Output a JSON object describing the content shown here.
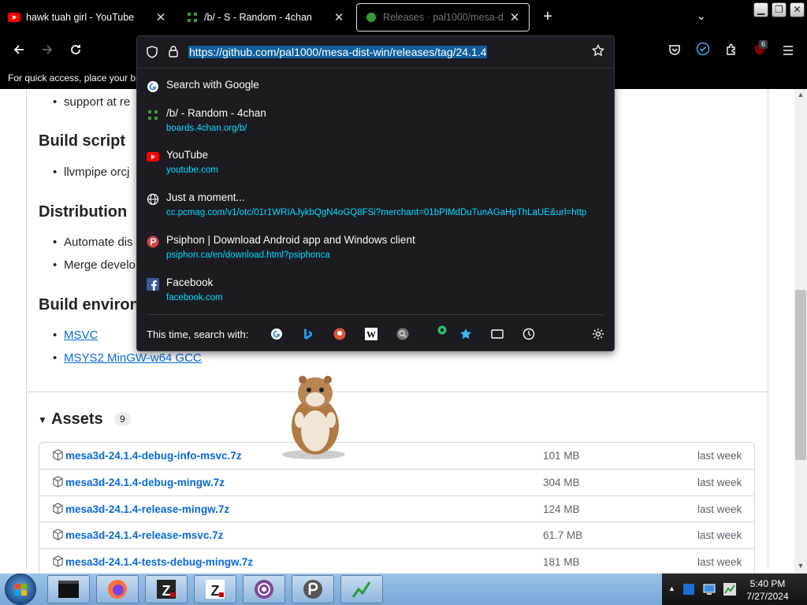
{
  "browser": {
    "tabs": [
      {
        "title": "hawk tuah girl - YouTube",
        "close": "✕"
      },
      {
        "title": "/b/ - S - Random - 4chan",
        "close": "✕"
      },
      {
        "title": "Releases · pal1000/mesa-d",
        "close": "✕"
      }
    ],
    "new_tab": "+",
    "list_tabs": "⌄",
    "window_controls": {
      "minimize": "▁",
      "restore": "❐",
      "close": "✕"
    },
    "extension_badge": "6",
    "bookmarks_text": "For quick access, place your bo"
  },
  "urlbar": {
    "url": "https://github.com/pal1000/mesa-dist-win/releases/tag/24.1.4",
    "suggestions": [
      {
        "title": "Search with Google",
        "url": "",
        "icon": "google-icon"
      },
      {
        "title": "/b/ - Random - 4chan",
        "url": "boards.4chan.org/b/",
        "icon": "4chan-icon"
      },
      {
        "title": "YouTube",
        "url": "youtube.com",
        "icon": "youtube-icon"
      },
      {
        "title": "Just a moment...",
        "url": "cc.pcmag.com/v1/otc/01r1WRIAJykbQgN4oGQ8FSi?merchant=01bPIMdDuTunAGaHpThLaUE&url=http",
        "icon": "globe-icon"
      },
      {
        "title": "Psiphon | Download Android app and Windows client",
        "url": "psiphon.ca/en/download.html?psiphonca",
        "icon": "psiphon-icon"
      },
      {
        "title": "Facebook",
        "url": "facebook.com",
        "icon": "facebook-icon"
      }
    ],
    "search_with_label": "This time, search with:"
  },
  "page": {
    "support_text": "support at re",
    "build_script_heading": "Build script",
    "build_script_item": "llvmpipe orcj",
    "distribution_heading": "Distribution",
    "distribution_items": [
      "Automate dis",
      "Merge develo"
    ],
    "build_env_heading": "Build environ",
    "build_env_links": [
      "MSVC",
      "MSYS2 MinGW-w64 GCC"
    ],
    "assets_heading": "Assets",
    "assets_count": "9",
    "assets": [
      {
        "name": "mesa3d-24.1.4-debug-info-msvc.7z",
        "size": "101 MB",
        "time": "last week"
      },
      {
        "name": "mesa3d-24.1.4-debug-mingw.7z",
        "size": "304 MB",
        "time": "last week"
      },
      {
        "name": "mesa3d-24.1.4-release-mingw.7z",
        "size": "124 MB",
        "time": "last week"
      },
      {
        "name": "mesa3d-24.1.4-release-msvc.7z",
        "size": "61.7 MB",
        "time": "last week"
      },
      {
        "name": "mesa3d-24.1.4-tests-debug-mingw.7z",
        "size": "181 MB",
        "time": "last week"
      }
    ]
  },
  "taskbar": {
    "time": "5:40 PM",
    "date": "7/27/2024"
  },
  "colors": {
    "link": "#0969da",
    "url_suggestion": "#00ddff",
    "panel_bg": "#1c1b22"
  }
}
